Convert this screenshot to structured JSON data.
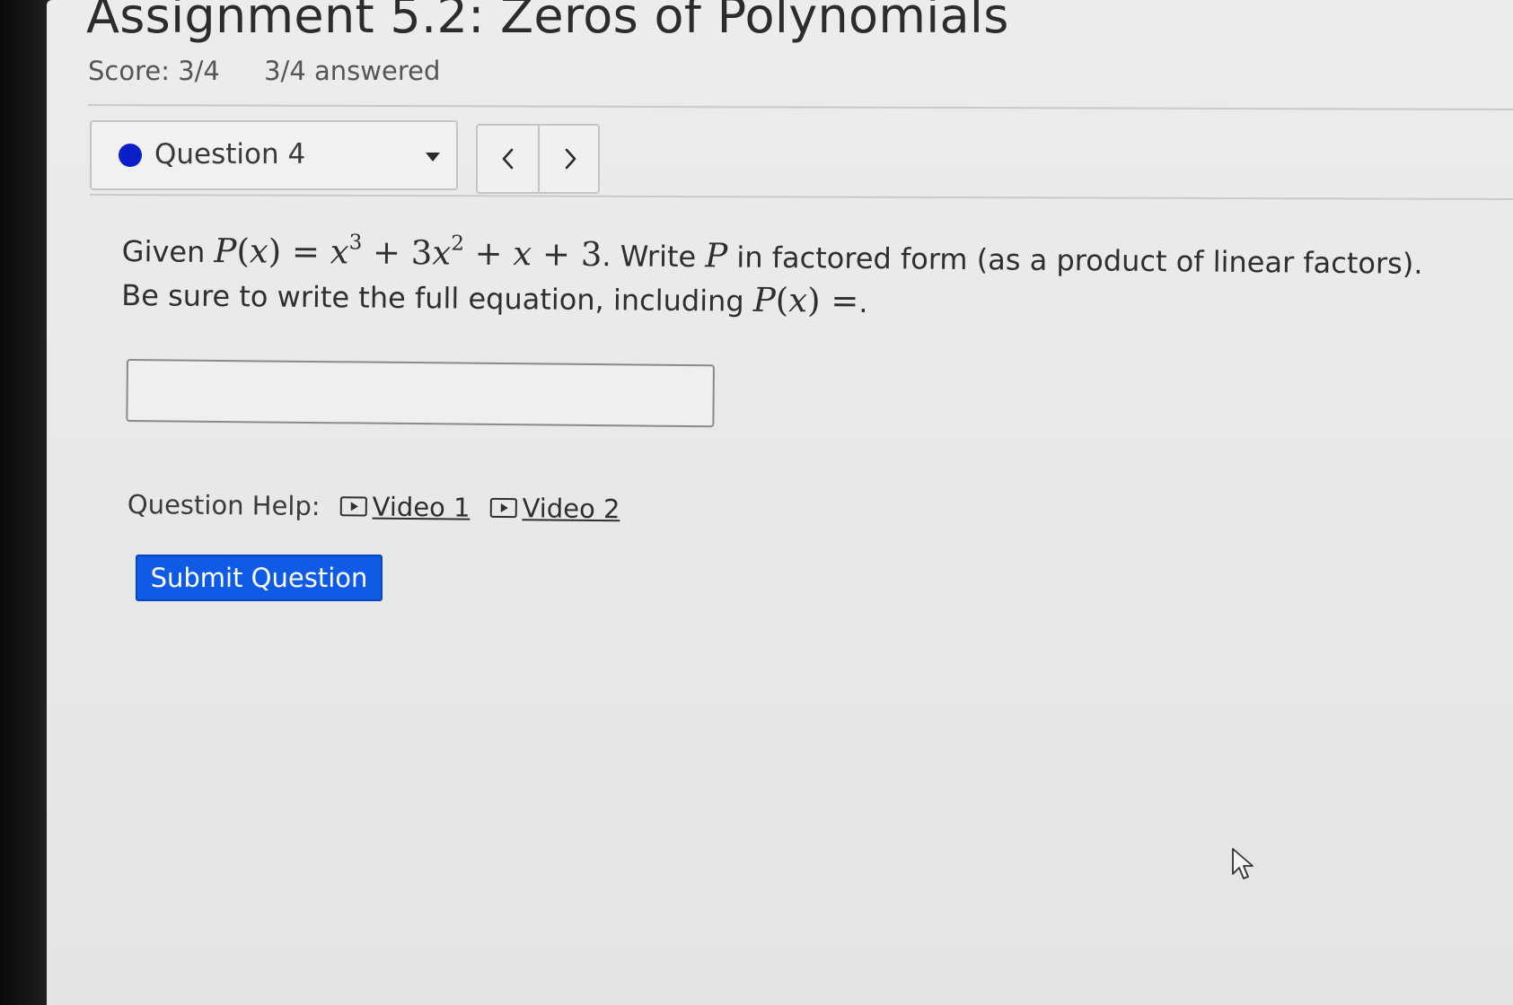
{
  "assignment": {
    "title": "Assignment 5.2: Zeros of Polynomials",
    "score": "Score: 3/4",
    "answered": "3/4 answered"
  },
  "question_nav": {
    "selected_question": "Question 4",
    "status_color": "#0a1fc8",
    "prev_icon": "chevron-left-icon",
    "next_icon": "chevron-right-icon"
  },
  "question": {
    "intro": "Given",
    "math_P": "P",
    "math_x": "x",
    "math_eq": "=",
    "math_x3": "x",
    "math_exp3": "3",
    "math_plus1": "+",
    "math_3x2_coef": "3",
    "math_x2": "x",
    "math_exp2": "2",
    "math_plus2": "+",
    "math_x1": "x",
    "math_plus3": "+",
    "math_const": "3",
    "sentence_1_mid": ". Write",
    "math_P2": "P",
    "sentence_1_end": "in factored form (as a product of linear factors).",
    "sentence_2_start": "Be sure to write the full equation, including",
    "math_P3": "P",
    "math_x4": "x",
    "math_eq2": "=",
    "sentence_2_end": "."
  },
  "answer": {
    "value": "",
    "placeholder": ""
  },
  "help": {
    "label": "Question Help:",
    "links": [
      "Video 1",
      "Video 2"
    ],
    "link_icon": "video-play-icon"
  },
  "submit": {
    "label": "Submit Question",
    "color": "#0f5be6"
  }
}
